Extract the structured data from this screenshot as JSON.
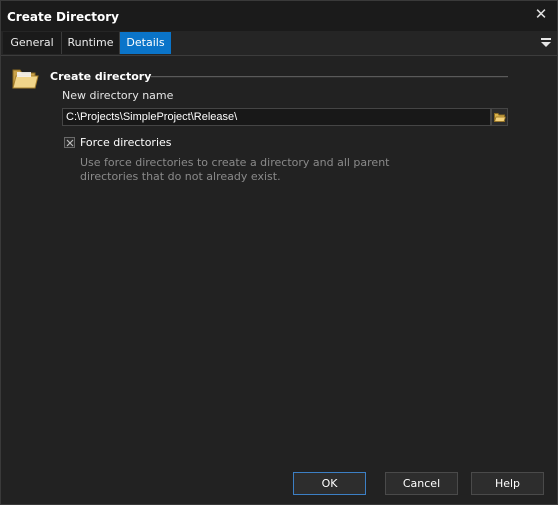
{
  "window": {
    "title": "Create Directory"
  },
  "tabs": [
    {
      "label": "General",
      "active": false
    },
    {
      "label": "Runtime",
      "active": false
    },
    {
      "label": "Details",
      "active": true
    }
  ],
  "section": {
    "title": "Create directory",
    "icon": "folder-icon"
  },
  "directory": {
    "label": "New directory name",
    "value": "C:\\Projects\\SimpleProject\\Release\\",
    "browse_icon": "folder-open-icon"
  },
  "force": {
    "checked": true,
    "label": "Force directories",
    "description": "Use force directories to create a directory and all parent directories that do not already exist."
  },
  "buttons": {
    "ok": "OK",
    "cancel": "Cancel",
    "help": "Help"
  },
  "colors": {
    "accent": "#0a74c9",
    "background": "#222222",
    "input_background": "#181818"
  }
}
